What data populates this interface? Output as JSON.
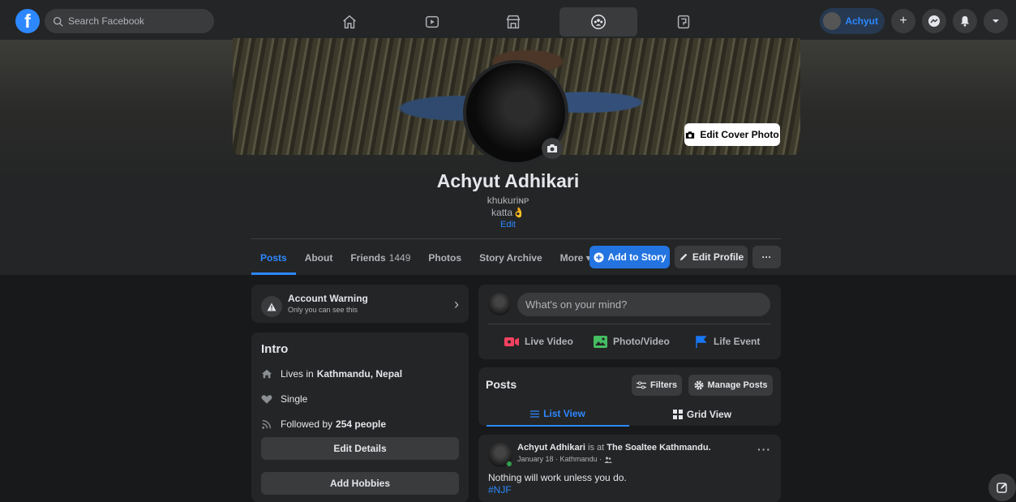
{
  "topbar": {
    "search_placeholder": "Search Facebook",
    "profile_name": "Achyut",
    "nav_items": [
      "home-icon",
      "watch-icon",
      "marketplace-icon",
      "groups-icon",
      "gaming-icon"
    ]
  },
  "profile": {
    "name": "Achyut Adhikari",
    "bio_line1": "khukuriɴᴘ",
    "bio_line2": "katta👌",
    "bio_edit": "Edit",
    "edit_cover_label": "Edit Cover Photo"
  },
  "tabs": {
    "posts": "Posts",
    "about": "About",
    "friends": "Friends",
    "friends_count": "1449",
    "photos": "Photos",
    "story_archive": "Story Archive",
    "more": "More ▾"
  },
  "actions": {
    "add_story": "Add to Story",
    "edit_profile": "Edit Profile",
    "more": "···"
  },
  "warning": {
    "title": "Account Warning",
    "subtitle": "Only you can see this"
  },
  "intro": {
    "title": "Intro",
    "lives_prefix": "Lives in",
    "lives_place": "Kathmandu, Nepal",
    "relationship": "Single",
    "followed_prefix": "Followed by",
    "followed_count": "254 people",
    "edit_details": "Edit Details",
    "add_hobbies": "Add Hobbies"
  },
  "composer": {
    "placeholder": "What's on your mind?",
    "live_video": "Live Video",
    "photo_video": "Photo/Video",
    "life_event": "Life Event"
  },
  "posts_section": {
    "title": "Posts",
    "filters": "Filters",
    "manage_posts": "Manage Posts",
    "list_view": "List View",
    "grid_view": "Grid View"
  },
  "post": {
    "author": "Achyut Adhikari",
    "is_at": "is at",
    "place": "The Soaltee Kathmandu.",
    "meta": "January 18 · Kathmandu ·",
    "text": "Nothing will work unless you do.",
    "hashtag": "#NJF",
    "more": "···"
  },
  "colors": {
    "background": "#18191a",
    "card": "#242526",
    "accent": "#2d88ff",
    "button_blue": "#2374e1"
  }
}
